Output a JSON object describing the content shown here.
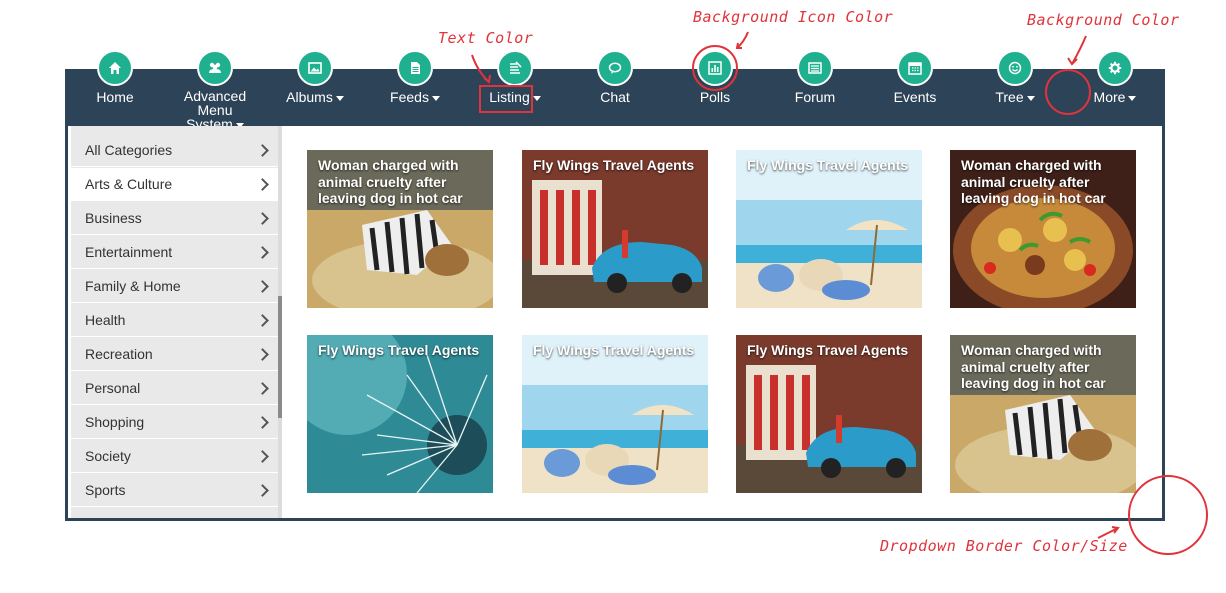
{
  "annotations": {
    "text_color": "Text Color",
    "background_icon_color": "Background Icon Color",
    "background_color": "Background Color",
    "dropdown_border": "Dropdown Border Color/Size"
  },
  "nav": {
    "home": "Home",
    "advanced_line1": "Advanced Menu",
    "advanced_line2": "System",
    "albums": "Albums",
    "feeds": "Feeds",
    "listing": "Listing",
    "chat": "Chat",
    "polls": "Polls",
    "forum": "Forum",
    "events": "Events",
    "tree": "Tree",
    "more": "More"
  },
  "categories": [
    "All Categories",
    "Arts & Culture",
    "Business",
    "Entertainment",
    "Family & Home",
    "Health",
    "Recreation",
    "Personal",
    "Shopping",
    "Society",
    "Sports"
  ],
  "tiles": [
    "Woman charged with animal cruelty after leaving dog in hot car",
    "Fly Wings Travel Agents",
    "Fly Wings Travel Agents",
    "Woman charged with animal cruelty after leaving dog in hot car",
    "Fly Wings Travel Agents",
    "Fly Wings Travel Agents",
    "Fly Wings Travel Agents",
    "Woman charged with animal cruelty after leaving dog in hot car"
  ],
  "colors": {
    "navbar": "#2d4358",
    "icon_bg": "#1fb08f",
    "annotation": "#e0333a"
  }
}
